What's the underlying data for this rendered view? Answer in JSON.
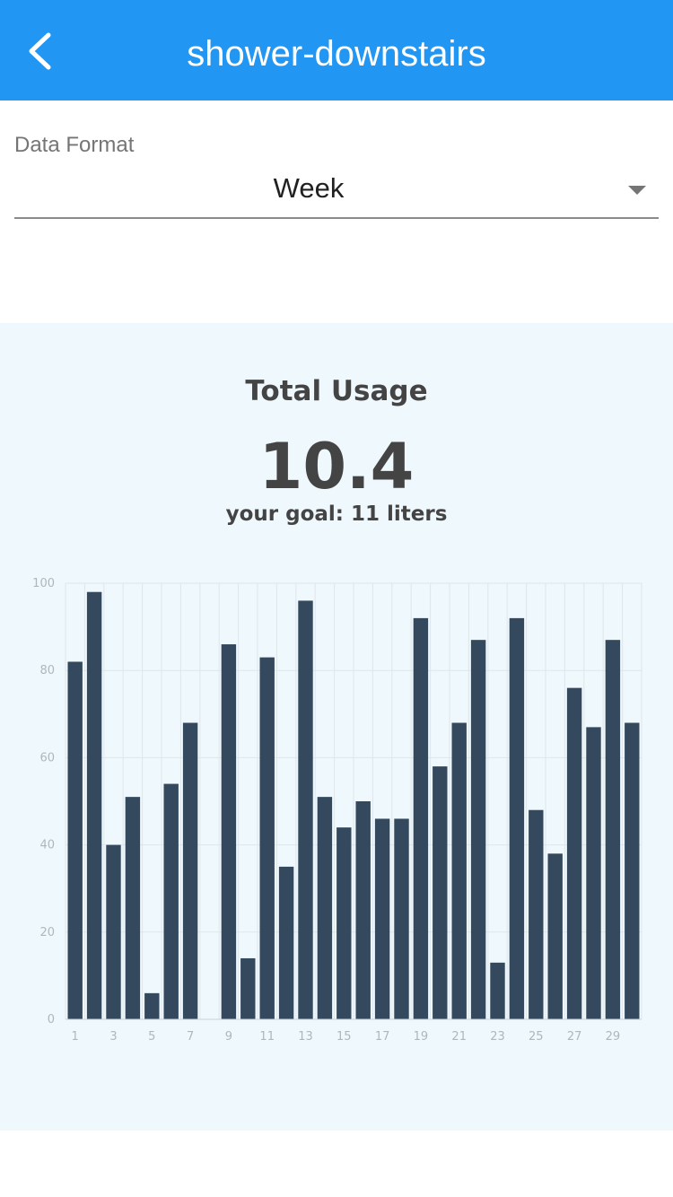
{
  "header": {
    "title": "shower-downstairs",
    "back_icon": "chevron-left-icon",
    "background_color": "#2196f3"
  },
  "filter": {
    "label": "Data Format",
    "selected": "Week",
    "options": [
      "Week"
    ],
    "dropdown_icon": "caret-down-icon"
  },
  "usage": {
    "title": "Total Usage",
    "value": "10.4",
    "goal_text": "your goal: 11 liters"
  },
  "chart_data": {
    "type": "bar",
    "x": [
      1,
      2,
      3,
      4,
      5,
      6,
      7,
      8,
      9,
      10,
      11,
      12,
      13,
      14,
      15,
      16,
      17,
      18,
      19,
      20,
      21,
      22,
      23,
      24,
      25,
      26,
      27,
      28,
      29,
      30
    ],
    "values": [
      82,
      98,
      40,
      51,
      6,
      54,
      68,
      0,
      86,
      14,
      83,
      35,
      96,
      51,
      44,
      50,
      46,
      46,
      92,
      58,
      68,
      87,
      13,
      92,
      48,
      38,
      76,
      67,
      87,
      68
    ],
    "x_tick_labels": [
      "1",
      "3",
      "5",
      "7",
      "9",
      "11",
      "13",
      "15",
      "17",
      "19",
      "21",
      "23",
      "25",
      "27",
      "29"
    ],
    "y_tick_labels": [
      "0",
      "20",
      "40",
      "60",
      "80",
      "100"
    ],
    "ylim": [
      0,
      100
    ],
    "grid": true,
    "bar_color": "#34495e",
    "panel_color": "#eff8fd",
    "title": "",
    "xlabel": "",
    "ylabel": ""
  }
}
